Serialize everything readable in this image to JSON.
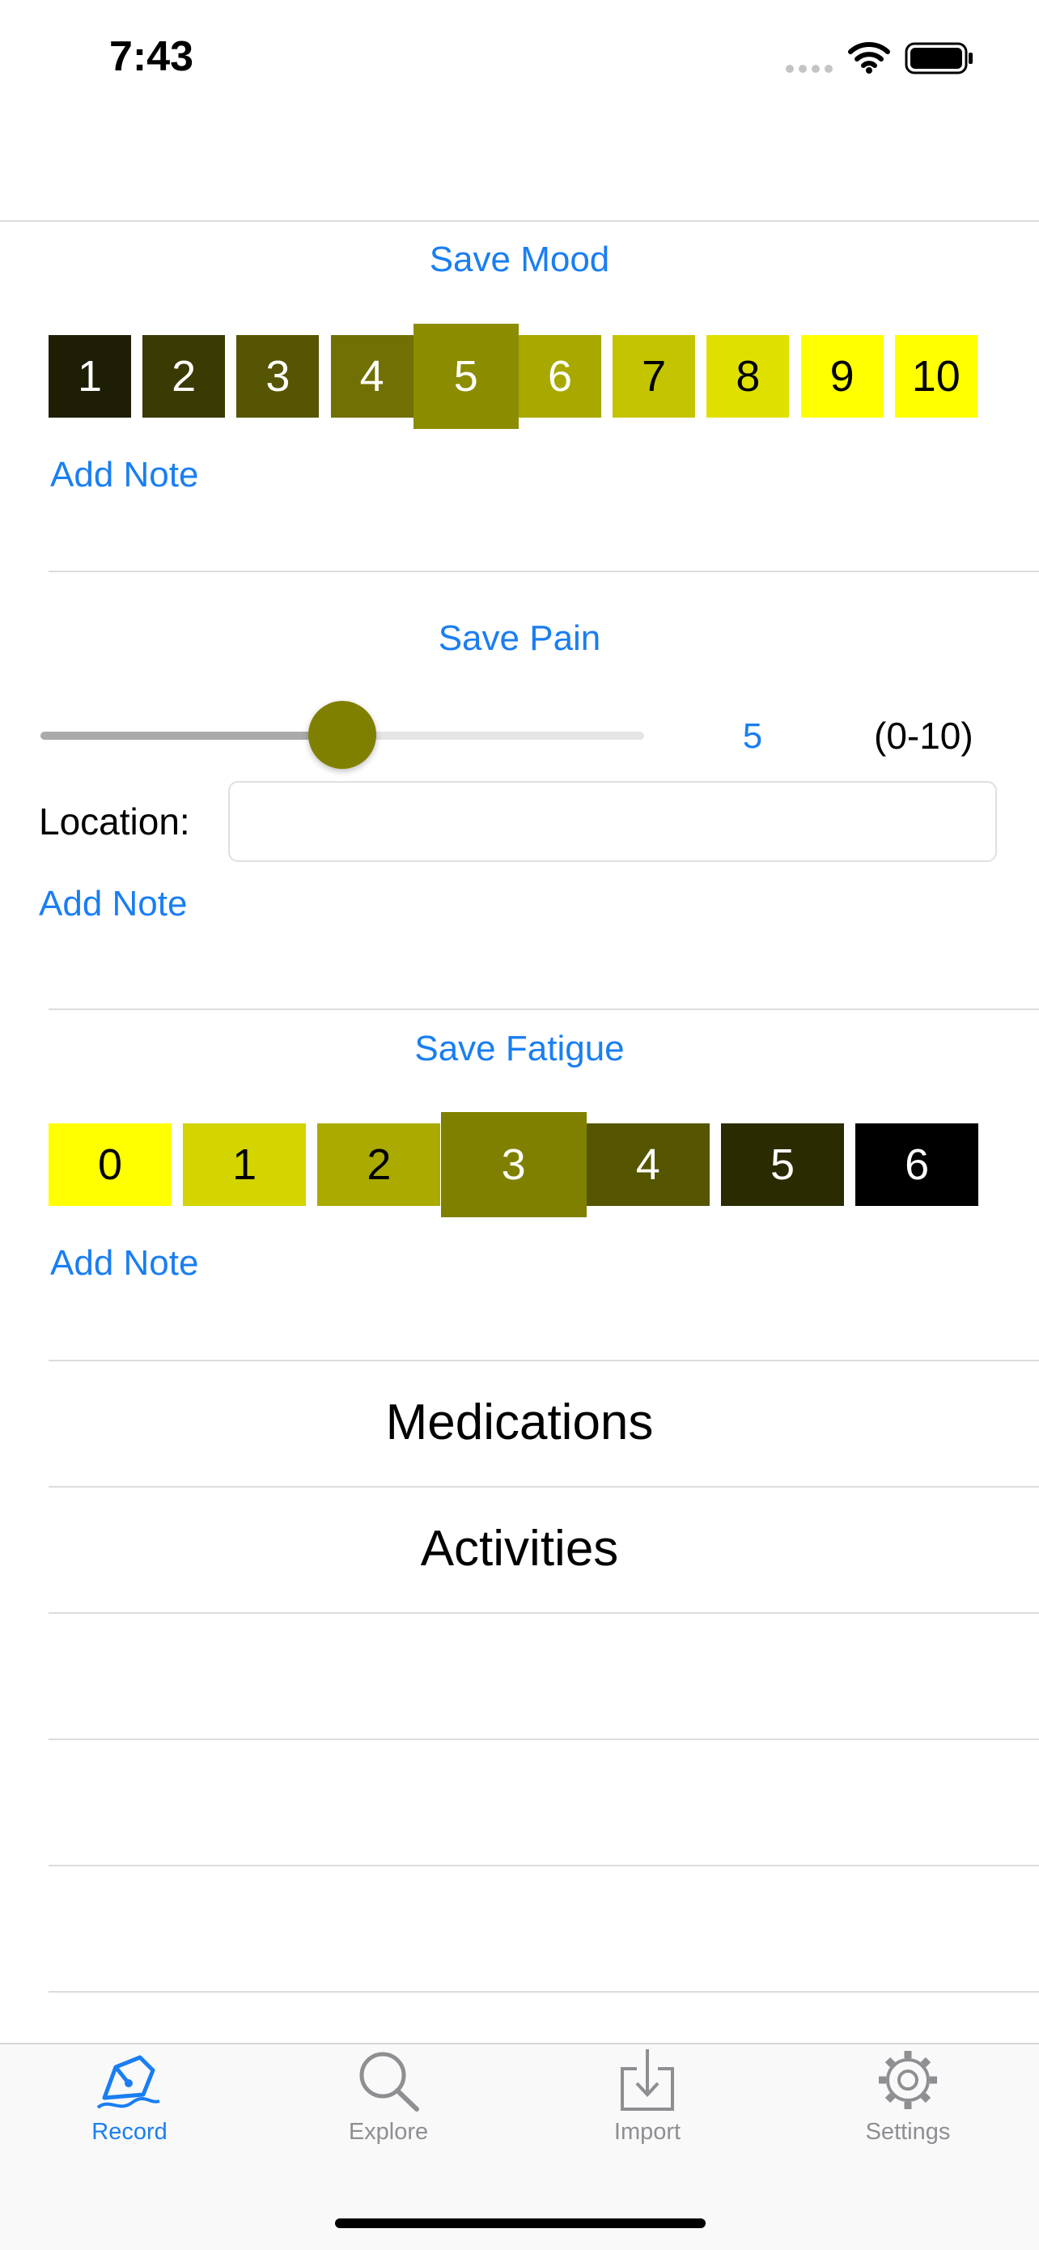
{
  "status_bar": {
    "time": "7:43"
  },
  "mood": {
    "save_label": "Save Mood",
    "add_note": "Add Note",
    "scale": [
      {
        "label": "1",
        "color": "#1e1e04"
      },
      {
        "label": "2",
        "color": "#3a3a03"
      },
      {
        "label": "3",
        "color": "#555503"
      },
      {
        "label": "4",
        "color": "#707004"
      },
      {
        "label": "5",
        "color": "#8c8c00"
      },
      {
        "label": "6",
        "color": "#a8a800"
      },
      {
        "label": "7",
        "color": "#c4c400"
      },
      {
        "label": "8",
        "color": "#e0e000"
      },
      {
        "label": "9",
        "color": "#ffff00"
      },
      {
        "label": "10",
        "color": "#ffff00"
      }
    ],
    "selected": "5"
  },
  "pain": {
    "save_label": "Save Pain",
    "value": "5",
    "range_label": "(0-10)",
    "slider_fraction": 0.5,
    "location_label": "Location:",
    "location_value": "",
    "add_note": "Add Note"
  },
  "fatigue": {
    "save_label": "Save Fatigue",
    "add_note": "Add Note",
    "scale": [
      {
        "label": "0",
        "color": "#ffff00"
      },
      {
        "label": "1",
        "color": "#d4d400"
      },
      {
        "label": "2",
        "color": "#aaaa00"
      },
      {
        "label": "3",
        "color": "#808000"
      },
      {
        "label": "4",
        "color": "#555500"
      },
      {
        "label": "5",
        "color": "#2b2b00"
      },
      {
        "label": "6",
        "color": "#000000"
      }
    ],
    "selected": "3"
  },
  "lists": {
    "medications": "Medications",
    "activities": "Activities"
  },
  "tab_bar": {
    "tabs": [
      {
        "label": "Record",
        "active": true
      },
      {
        "label": "Explore",
        "active": false
      },
      {
        "label": "Import",
        "active": false
      },
      {
        "label": "Settings",
        "active": false
      }
    ]
  }
}
